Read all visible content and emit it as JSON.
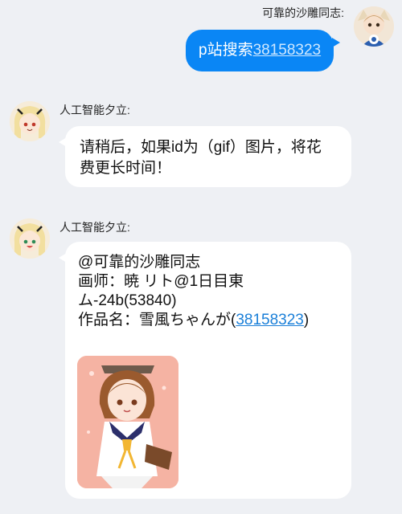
{
  "sender": {
    "name": "可靠的沙雕同志:",
    "message_prefix": "p站搜索",
    "message_id": "38158323"
  },
  "bot_reply_1": {
    "name": "人工智能夕立:",
    "lines": [
      "请稍后，如果id为（gif）图片，将花",
      "费更长时间！"
    ]
  },
  "bot_reply_2": {
    "name": "人工智能夕立:",
    "mention": "@可靠的沙雕同志",
    "artist_line1": "画师：暁 リト@1日目東",
    "artist_line2": "ム-24b(53840)",
    "work_prefix": "作品名：雪風ちゃんが(",
    "work_id": "38158323",
    "work_suffix": ")"
  },
  "colors": {
    "outgoing_bubble": "#0a86f5",
    "incoming_bubble": "#ffffff",
    "background": "#eef0f4",
    "link": "#1a7fd8"
  },
  "icons": [
    "sender-avatar",
    "bot-avatar",
    "artwork-thumbnail"
  ]
}
